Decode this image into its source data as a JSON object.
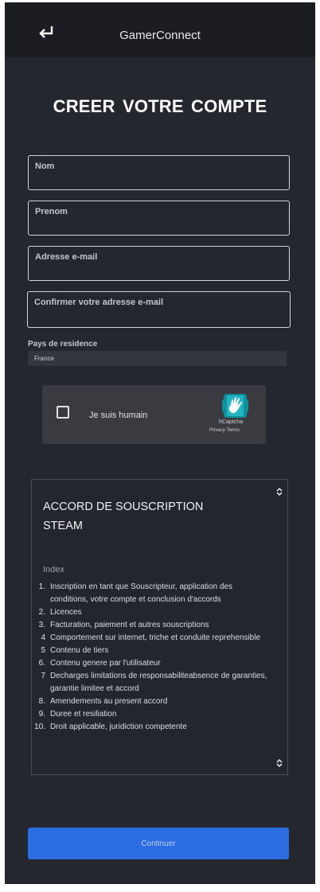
{
  "header": {
    "back_icon": "return-arrow-icon",
    "title": "GamerConnect"
  },
  "page_title": "CREER VOTRE COMPTE",
  "form": {
    "fields": [
      {
        "label": "Nom",
        "value": ""
      },
      {
        "label": "Prenom",
        "value": ""
      },
      {
        "label": "Adresse e-mail",
        "value": ""
      },
      {
        "label": "Confirmer votre adresse e-mail",
        "value": ""
      }
    ],
    "country_label": "Pays de residence",
    "country_value": "France"
  },
  "captcha": {
    "text": "Je suis humain",
    "brand": "hCaptcha",
    "links": "Privacy-Terms",
    "logo_icon": "hcaptcha-logo-icon"
  },
  "agreement": {
    "title": "ACCORD DE SOUSCRIPTION STEAM",
    "index_label": "Index",
    "items": [
      {
        "num": "1.",
        "text": "Inscription en tant que Souscripteur, application des conditions, votre compte et conclusion d'accords"
      },
      {
        "num": "2.",
        "text": "Licences"
      },
      {
        "num": "3.",
        "text": "Facturation, paiement et autres souscriptions"
      },
      {
        "num": "4",
        "text": "Comportement sur internet, triche et conduite reprehensible"
      },
      {
        "num": "5",
        "text": "Contenu de tiers"
      },
      {
        "num": "6.",
        "text": "Contenu genere par l'utilisateur"
      },
      {
        "num": "7",
        "text": "Decharges limitations de responsabiliteabsence de garanties, garantie limitee et accord"
      },
      {
        "num": "8.",
        "text": "Amendements au present accord"
      },
      {
        "num": "9.",
        "text": "Duree et resiliation"
      },
      {
        "num": "10.",
        "text": " Droit applicable, juridiction competente"
      }
    ]
  },
  "continue_label": "Continuer",
  "colors": {
    "background": "#24272e",
    "header": "#1b1d23",
    "accent": "#2b6ce0"
  }
}
